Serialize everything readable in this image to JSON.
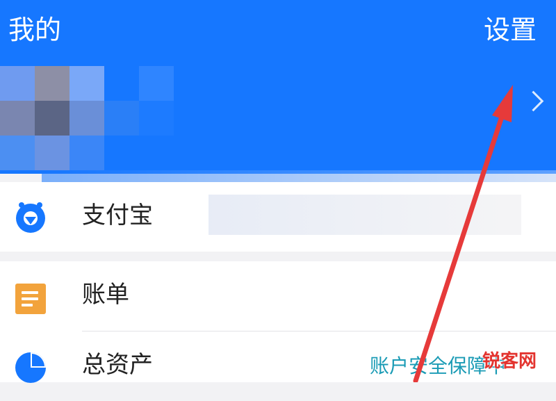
{
  "header": {
    "title": "我的",
    "settings_label": "设置",
    "background_color": "#1677ff"
  },
  "profile": {
    "avatar": "pixelated-avatar",
    "chevron_icon": "chevron-right-icon"
  },
  "menu": {
    "items": [
      {
        "label": "支付宝",
        "icon": "alipay-icon"
      },
      {
        "label": "账单",
        "icon": "bill-icon"
      },
      {
        "label": "总资产",
        "icon": "pie-chart-icon",
        "note": "账户安全保障中"
      }
    ]
  },
  "annotation": {
    "type": "red-arrow",
    "color": "#e63a3a",
    "points_to": "settings-button"
  },
  "watermark": {
    "text": "锐客网",
    "color": "#e3342f"
  }
}
